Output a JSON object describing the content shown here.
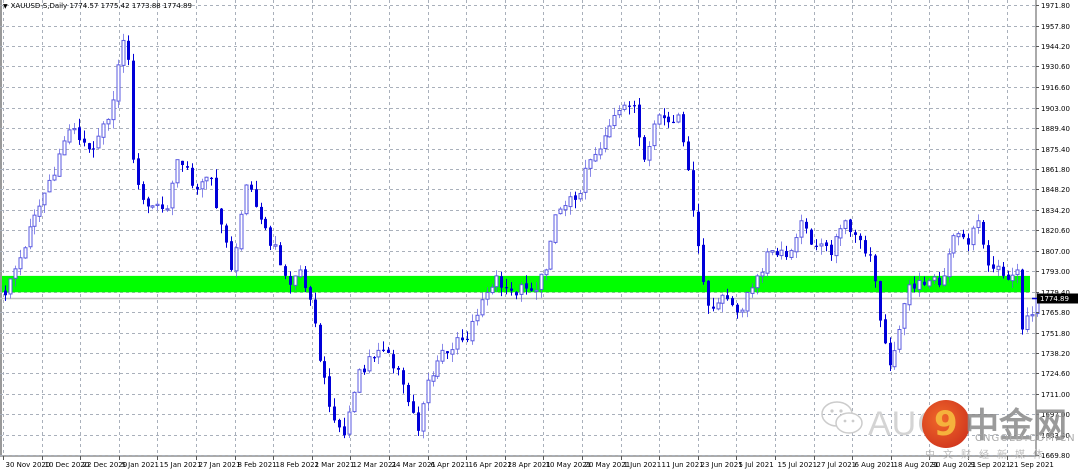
{
  "header": {
    "symbol": "XAUUSD-S,Daily",
    "open": "1774.57",
    "high": "1775.42",
    "low": "1773.88",
    "close": "1774.89"
  },
  "current_price_label": "1774.89",
  "colors": {
    "bull": "#5a5ae0",
    "bear": "#0000d8",
    "zone": "#00ff00",
    "grid": "#a9b0bb",
    "price_line": "#c0c0c0"
  },
  "watermark": {
    "brand_latin": "AUG",
    "brand_cn": "中金网",
    "site": "CNGOLD.COM.CN",
    "tagline": "中文财经新媒体",
    "logo_glyph": "9"
  },
  "chart_data": {
    "type": "candlestick",
    "title": "XAUUSD-S,Daily",
    "ylim": [
      1669.8,
      1971.8
    ],
    "y_ticks": [
      "1971.80",
      "1957.80",
      "1944.20",
      "1930.60",
      "1916.60",
      "1903.00",
      "1889.40",
      "1875.40",
      "1861.80",
      "1848.20",
      "1834.20",
      "1820.60",
      "1807.00",
      "1793.00",
      "1779.40",
      "1765.80",
      "1751.80",
      "1738.20",
      "1724.60",
      "1711.00",
      "1697.00",
      "1683.40",
      "1669.80"
    ],
    "x_ticks": [
      "30 Nov 2020",
      "10 Dec 2020",
      "22 Dec 2020",
      "5 Jan 2021",
      "15 Jan 2021",
      "27 Jan 2021",
      "8 Feb 2021",
      "18 Feb 2021",
      "2 Mar 2021",
      "12 Mar 2021",
      "24 Mar 2021",
      "6 Apr 2021",
      "16 Apr 2021",
      "28 Apr 2021",
      "10 May 2021",
      "20 May 2021",
      "1 Jun 2021",
      "11 Jun 2021",
      "23 Jun 2021",
      "5 Jul 2021",
      "15 Jul 2021",
      "27 Jul 2021",
      "6 Aug 2021",
      "18 Aug 2021",
      "30 Aug 2021",
      "9 Sep 2021",
      "21 Sep 2021"
    ],
    "support_zone": [
      1779,
      1790
    ],
    "last_price": 1774.89,
    "bar_count": 211,
    "close_anchors": [
      [
        0,
        1777
      ],
      [
        13,
        1888
      ],
      [
        18,
        1875
      ],
      [
        21,
        1895
      ],
      [
        24,
        1948
      ],
      [
        25,
        1935
      ],
      [
        26,
        1868
      ],
      [
        28,
        1841
      ],
      [
        33,
        1835
      ],
      [
        35,
        1868
      ],
      [
        39,
        1848
      ],
      [
        42,
        1855
      ],
      [
        46,
        1794
      ],
      [
        49,
        1851
      ],
      [
        53,
        1822
      ],
      [
        58,
        1784
      ],
      [
        60,
        1794
      ],
      [
        62,
        1774
      ],
      [
        64,
        1733
      ],
      [
        67,
        1693
      ],
      [
        69,
        1683
      ],
      [
        72,
        1727
      ],
      [
        76,
        1740
      ],
      [
        80,
        1727
      ],
      [
        84,
        1686
      ],
      [
        86,
        1720
      ],
      [
        89,
        1740
      ],
      [
        94,
        1747
      ],
      [
        97,
        1774
      ],
      [
        100,
        1790
      ],
      [
        103,
        1780
      ],
      [
        107,
        1780
      ],
      [
        110,
        1794
      ],
      [
        112,
        1831
      ],
      [
        116,
        1841
      ],
      [
        119,
        1868
      ],
      [
        122,
        1884
      ],
      [
        125,
        1901
      ],
      [
        128,
        1904
      ],
      [
        130,
        1868
      ],
      [
        133,
        1898
      ],
      [
        137,
        1898
      ],
      [
        139,
        1861
      ],
      [
        141,
        1810
      ],
      [
        143,
        1770
      ],
      [
        146,
        1777
      ],
      [
        150,
        1767
      ],
      [
        153,
        1790
      ],
      [
        156,
        1807
      ],
      [
        160,
        1807
      ],
      [
        162,
        1827
      ],
      [
        164,
        1811
      ],
      [
        168,
        1804
      ],
      [
        171,
        1827
      ],
      [
        174,
        1814
      ],
      [
        176,
        1804
      ],
      [
        178,
        1760
      ],
      [
        180,
        1730
      ],
      [
        182,
        1754
      ],
      [
        184,
        1784
      ],
      [
        187,
        1784
      ],
      [
        191,
        1790
      ],
      [
        193,
        1817
      ],
      [
        196,
        1811
      ],
      [
        198,
        1827
      ],
      [
        200,
        1797
      ],
      [
        203,
        1790
      ],
      [
        206,
        1794
      ],
      [
        207,
        1754
      ],
      [
        209,
        1764
      ],
      [
        210,
        1774.89
      ]
    ]
  }
}
